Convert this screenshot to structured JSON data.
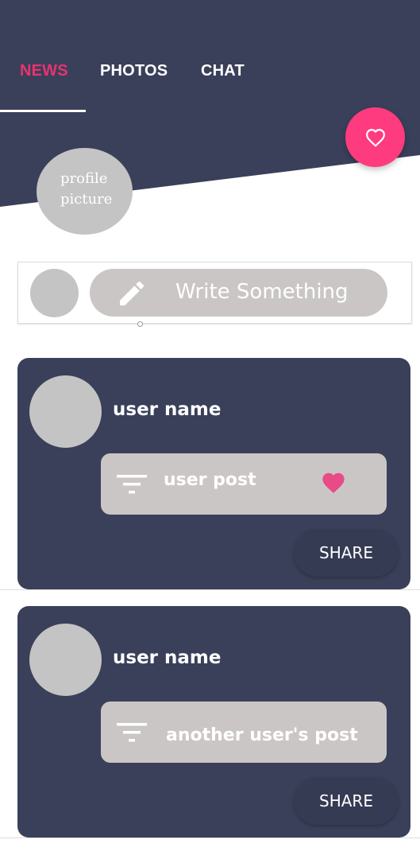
{
  "header": {
    "tabs": [
      {
        "label": "NEWS",
        "active": true
      },
      {
        "label": "PHOTOS",
        "active": false
      },
      {
        "label": "CHAT",
        "active": false
      }
    ],
    "fab_icon": "heart-outline-icon",
    "profile_picture": {
      "line1": "profile",
      "line2": "picture"
    }
  },
  "composer": {
    "placeholder": "Write Something",
    "icon": "pencil-icon"
  },
  "posts": [
    {
      "user_name": "user name",
      "post_text": "user post",
      "liked": true,
      "share_label": "SHARE"
    },
    {
      "user_name": "user name",
      "post_text": "another user's post",
      "liked": false,
      "share_label": "SHARE"
    }
  ],
  "colors": {
    "navy": "#3a405a",
    "accent_pink": "#ff3b7f",
    "active_tab": "#e8336f",
    "placeholder_gray": "#c4c4c4",
    "input_gray": "#cbc6c6"
  }
}
